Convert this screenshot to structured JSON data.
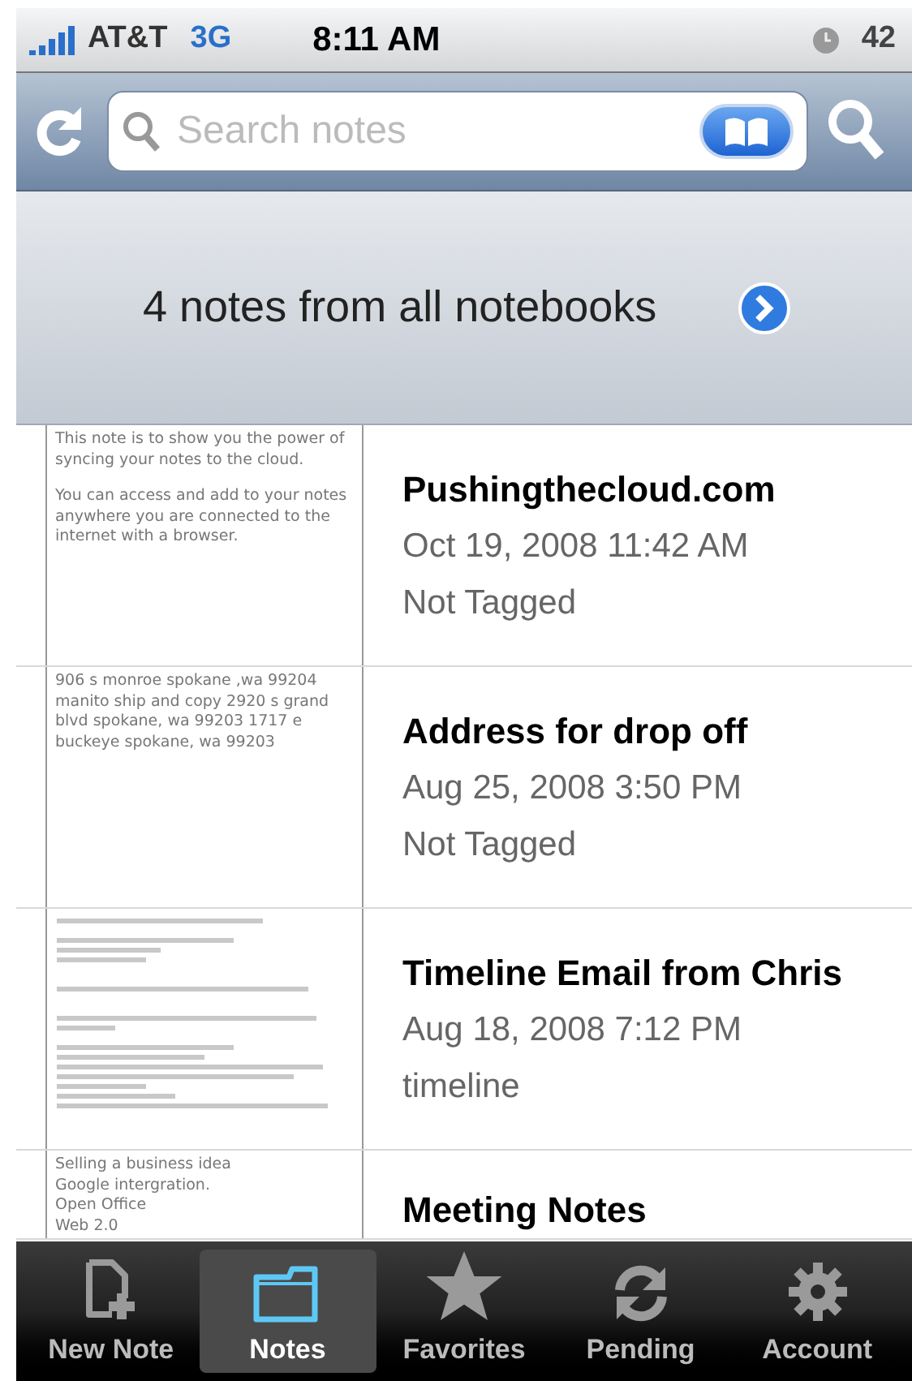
{
  "status_bar": {
    "carrier": "AT&T",
    "network": "3G",
    "time": "8:11 AM",
    "battery": "42"
  },
  "search": {
    "placeholder": "Search notes"
  },
  "header": {
    "title": "4 notes from all notebooks"
  },
  "notes": [
    {
      "kind": "text",
      "preview": [
        "This note is to show you the power of syncing your notes to the cloud.",
        "You can access and add to your notes anywhere you are connected to the internet with a browser."
      ],
      "title": "Pushingthecloud.com",
      "date": "Oct 19, 2008 11:42 AM",
      "tags": "Not Tagged"
    },
    {
      "kind": "text",
      "preview": [
        "906 s monroe spokane ,wa 99204 manito ship and copy 2920 s grand blvd spokane, wa 99203 1717 e buckeye spokane, wa 99203"
      ],
      "title": "Address for drop off",
      "date": "Aug 25, 2008 3:50 PM",
      "tags": "Not Tagged"
    },
    {
      "kind": "email",
      "title": "Timeline Email from Chris",
      "date": "Aug 18, 2008 7:12 PM",
      "tags": "timeline"
    },
    {
      "kind": "lines",
      "preview": [
        "Selling a business idea",
        "Google intergration.",
        "Open Office",
        "Web 2.0"
      ],
      "title": "Meeting Notes"
    }
  ],
  "tabs": [
    {
      "label": "New Note",
      "selected": false
    },
    {
      "label": "Notes",
      "selected": true
    },
    {
      "label": "Favorites",
      "selected": false
    },
    {
      "label": "Pending",
      "selected": false
    },
    {
      "label": "Account",
      "selected": false
    }
  ]
}
